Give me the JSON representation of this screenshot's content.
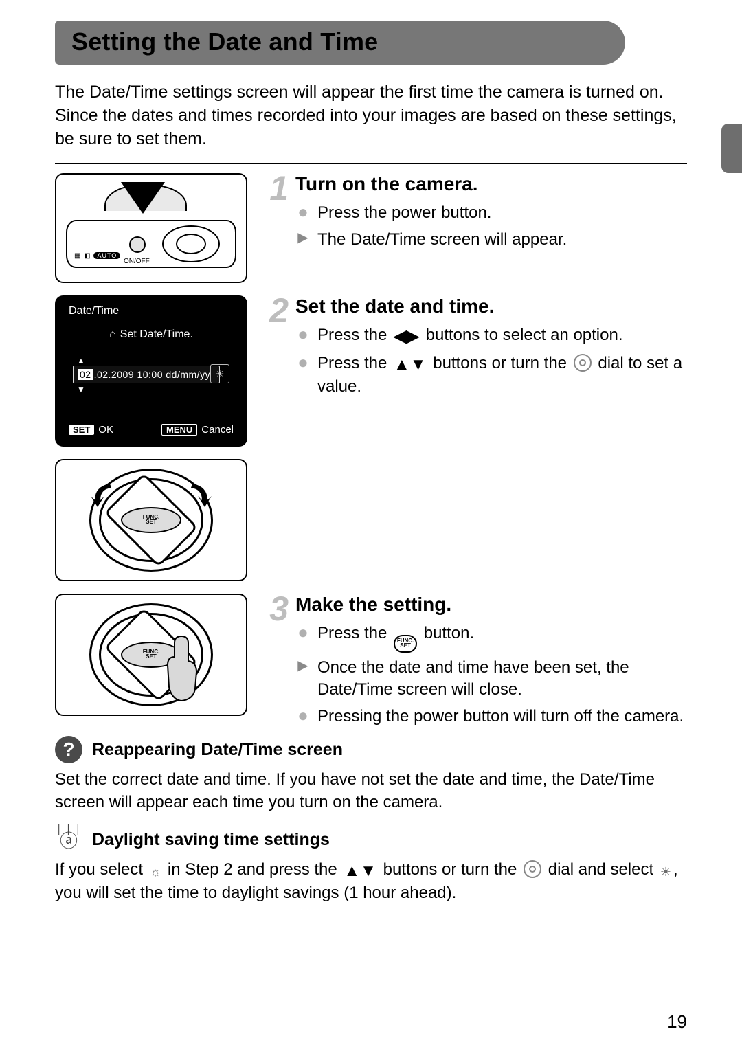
{
  "page": {
    "title": "Setting the Date and Time",
    "intro": "The Date/Time settings screen will appear the first time the camera is turned on. Since the dates and times recorded into your images are based on these settings, be sure to set them.",
    "pageNumber": "19"
  },
  "cameraTop": {
    "onoff": "ON/OFF",
    "autoPill": "AUTO"
  },
  "lcd": {
    "title": "Date/Time",
    "message": "Set Date/Time.",
    "dateHighlighted": "02",
    "dateRest": ".02.2009 10:00 dd/mm/yy",
    "setBadge": "SET",
    "ok": "OK",
    "menuBadge": "MENU",
    "cancel": "Cancel"
  },
  "funcLabel": {
    "top": "FUNC.",
    "bot": "SET"
  },
  "steps": [
    {
      "num": "1",
      "title": "Turn on the camera.",
      "items": [
        {
          "k": "dot",
          "text": "Press the power button."
        },
        {
          "k": "tri",
          "text": "The Date/Time screen will appear."
        }
      ]
    },
    {
      "num": "2",
      "title": "Set the date and time.",
      "items": [
        {
          "k": "dot",
          "pre": "Press the ",
          "mid1": "◀▶",
          "post": " buttons to select an option."
        },
        {
          "k": "dot",
          "pre": "Press the ",
          "mid1": "▲▼",
          "mid2": " buttons or turn the ",
          "post": " dial to set a value."
        }
      ]
    },
    {
      "num": "3",
      "title": "Make the setting.",
      "items": [
        {
          "k": "dot",
          "pre": "Press the ",
          "post": " button."
        },
        {
          "k": "tri",
          "text": "Once the date and time have been set, the Date/Time screen will close."
        },
        {
          "k": "dot",
          "text": "Pressing the power button will turn off the camera."
        }
      ]
    }
  ],
  "notes": {
    "reappear": {
      "title": "Reappearing Date/Time screen",
      "text": "Set the correct date and time. If you have not set the date and time, the Date/Time screen will appear each time you turn on the camera."
    },
    "dst": {
      "title": "Daylight saving time settings",
      "pre": "If you select ",
      "mid1": " in Step 2 and press the ",
      "arrows": "▲▼",
      "mid2": " buttons or turn the ",
      "mid3": " dial and select ",
      "post": ", you will set the time to daylight savings (1 hour ahead)."
    }
  }
}
